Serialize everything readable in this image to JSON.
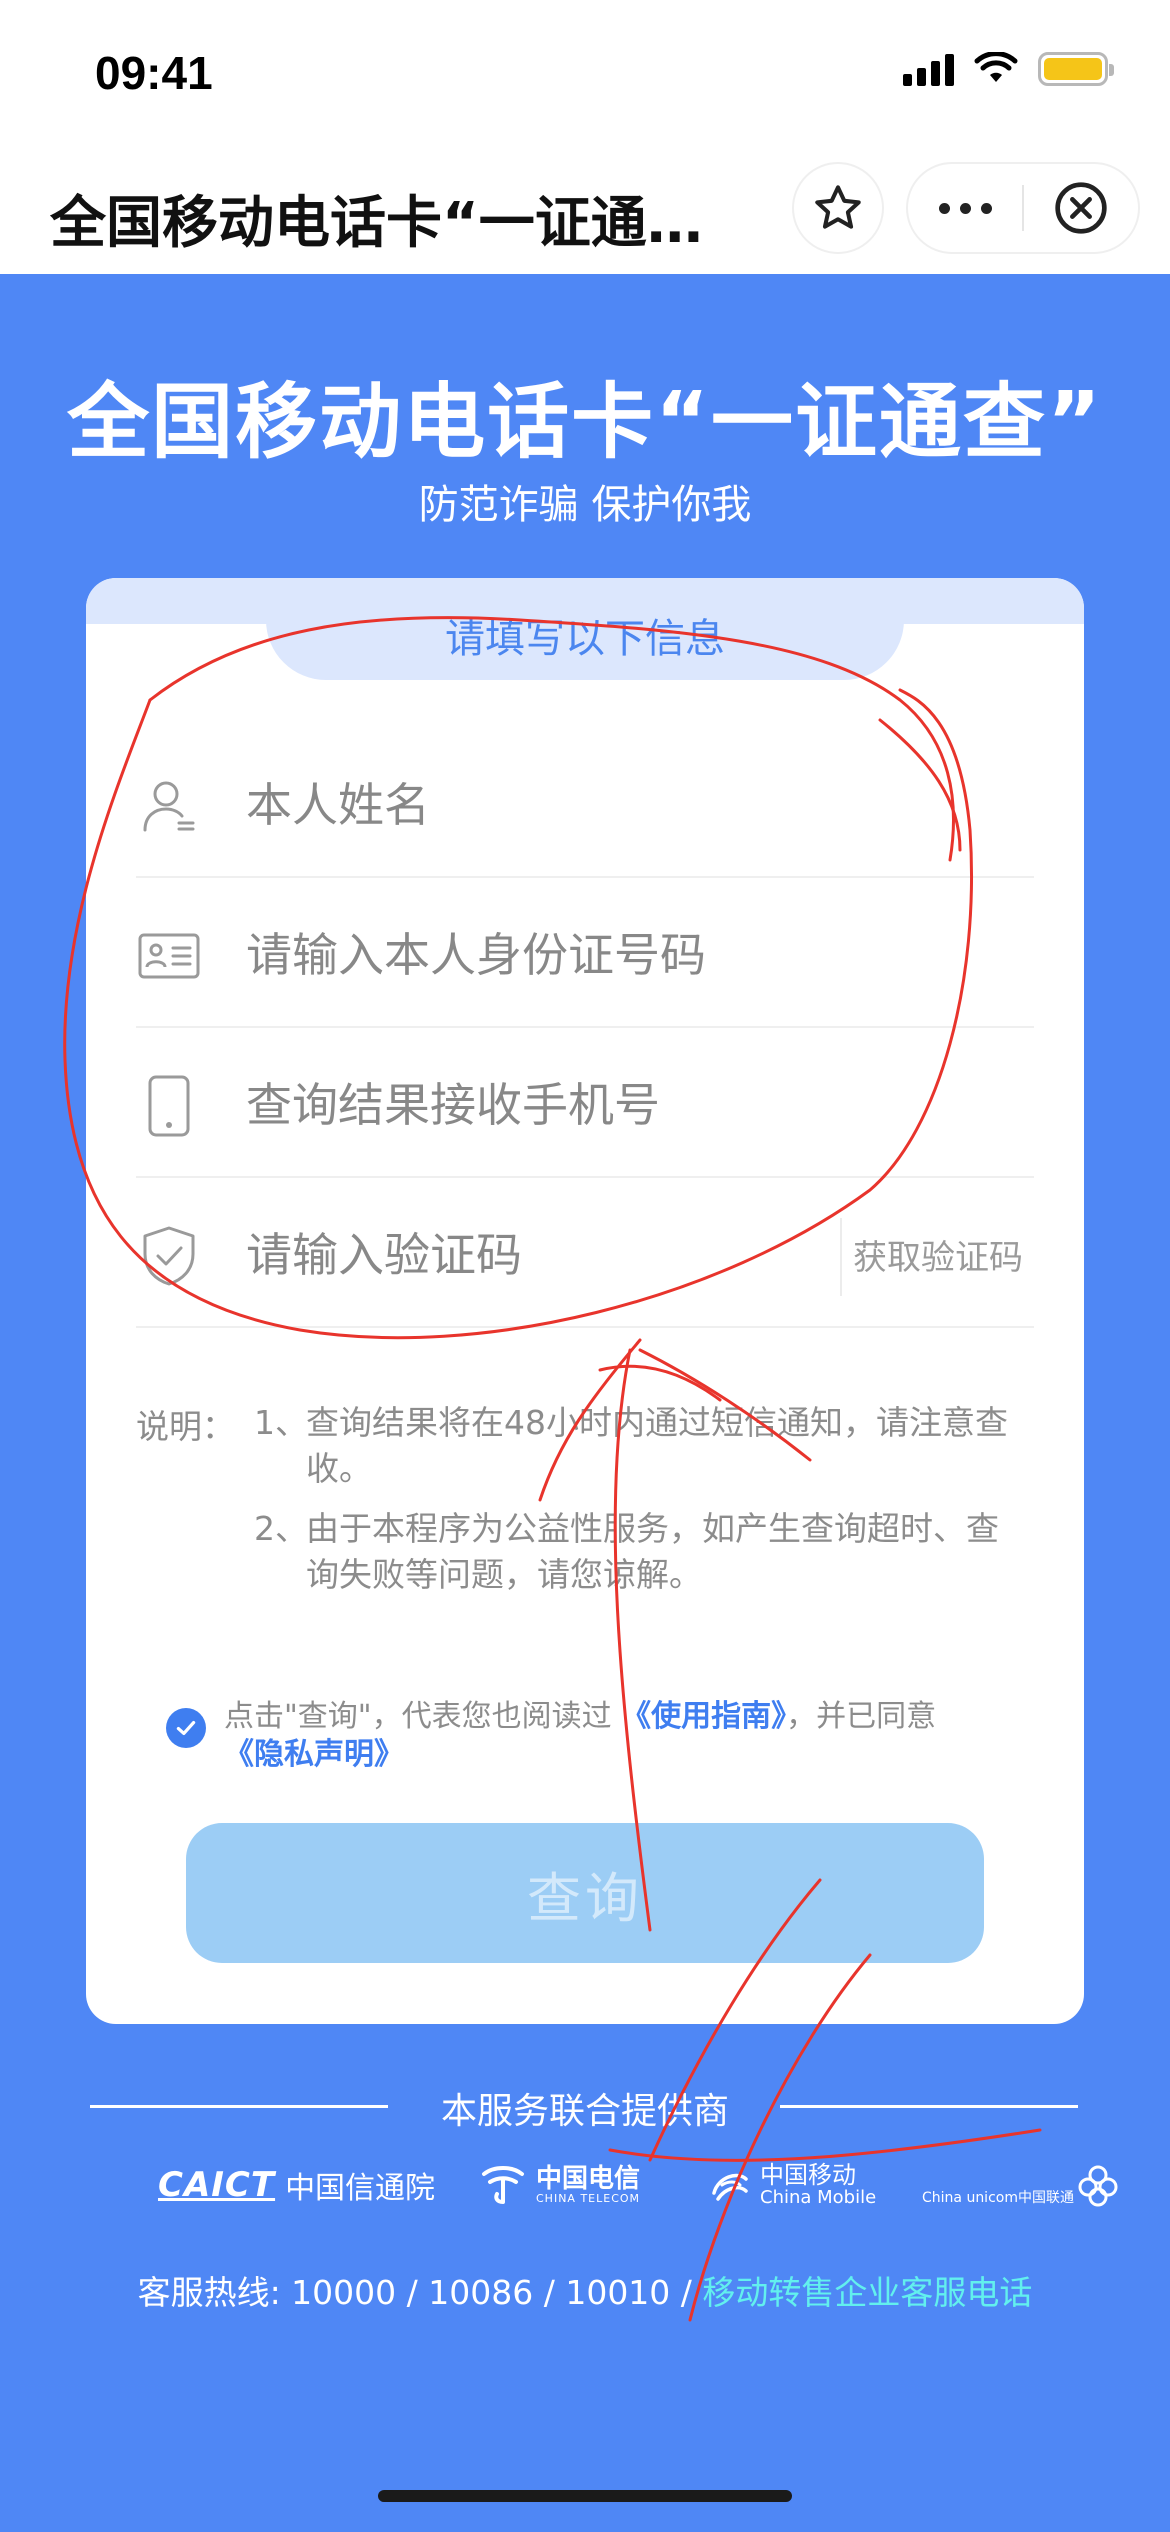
{
  "status_bar": {
    "time": "09:41"
  },
  "nav": {
    "title": "全国移动电话卡“一证通…"
  },
  "hero": {
    "title": "全国移动电话卡“一证通查”",
    "subtitle": "防范诈骗 保护你我"
  },
  "form": {
    "header": "请填写以下信息",
    "name_placeholder": "本人姓名",
    "id_placeholder": "请输入本人身份证号码",
    "phone_placeholder": "查询结果接收手机号",
    "code_placeholder": "请输入验证码",
    "get_code_label": "获取验证码"
  },
  "notes": {
    "label": "说明：",
    "items": [
      {
        "num": "1、",
        "text": "查询结果将在48小时内通过短信通知，请注意查收。"
      },
      {
        "num": "2、",
        "text": "由于本程序为公益性服务，如产生查询超时、查询失败等问题，请您谅解。"
      }
    ]
  },
  "agreement": {
    "checked": true,
    "prefix": "点击\"查询\"，代表您也阅读过",
    "guide_link": "《使用指南》",
    "middle": "，并已同意",
    "privacy_link": "《隐私声明》"
  },
  "query_button": "查询",
  "footer": {
    "providers_title": "本服务联合提供商",
    "logos": {
      "caict_en": "CAICT",
      "caict_cn": "中国信通院",
      "telecom_cn": "中国电信",
      "telecom_en": "CHINA TELECOM",
      "mobile_cn": "中国移动",
      "mobile_en": "China Mobile",
      "unicom_text": "China unicom中国联通"
    },
    "hotline_prefix": "客服热线: 10000 / 10086 / 10010 /",
    "hotline_link": "移动转售企业客服电话"
  },
  "colors": {
    "background": "#4f87f5",
    "accent": "#3f7ef0",
    "button_disabled": "#9ccdf5",
    "hotline_link": "#62f0ee",
    "annotation_stroke": "#e8342c"
  }
}
